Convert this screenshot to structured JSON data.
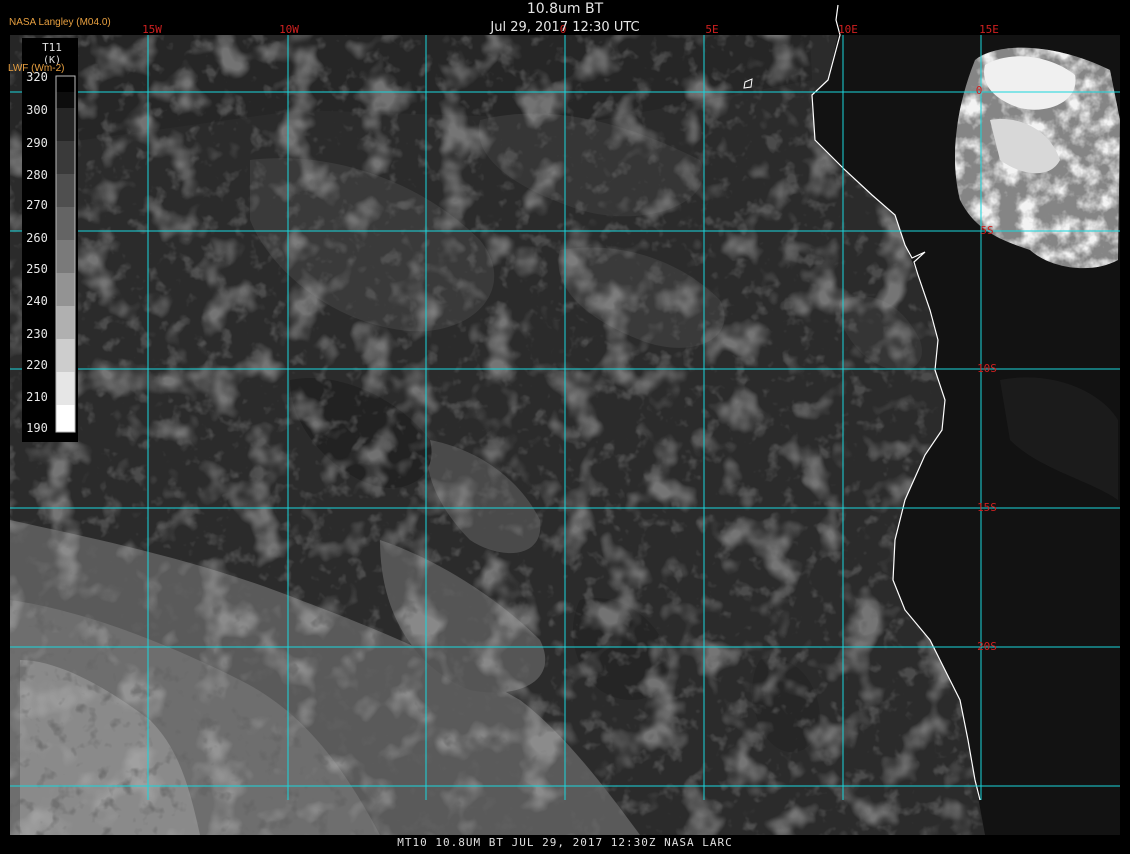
{
  "header": {
    "title": "10.8um BT",
    "datetime": "Jul 29, 2017 12:30 UTC",
    "provider": "NASA Langley (M04.0)"
  },
  "legend": {
    "variable": "T11",
    "unit": "(K)",
    "secondary_label": "LWF (Wm-2)",
    "ticks": [
      "320",
      "300",
      "290",
      "280",
      "270",
      "260",
      "250",
      "240",
      "230",
      "220",
      "210",
      "190"
    ]
  },
  "grid": {
    "lon_labels": [
      "15W",
      "10W",
      "0",
      "5E",
      "10E",
      "15E"
    ],
    "lat_labels": [
      "0",
      "5S",
      "10S",
      "15S",
      "20S"
    ]
  },
  "footer": "MT10  10.8UM BT   JUL 29, 2017 12:30Z  NASA LARC",
  "colors": {
    "grid": "#19d6dc",
    "grid_label": "#d02020",
    "coastline": "#ffffff",
    "ocean": "#222222",
    "land": "#484848"
  }
}
